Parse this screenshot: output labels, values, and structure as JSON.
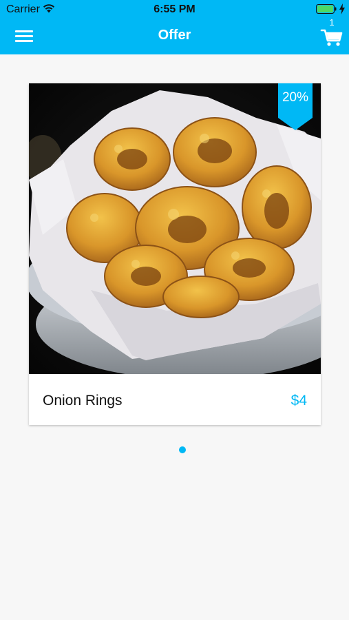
{
  "status_bar": {
    "carrier": "Carrier",
    "time": "6:55 PM"
  },
  "navbar": {
    "title": "Offer",
    "cart_count": "1",
    "menu_icon": "hamburger-menu-icon",
    "cart_icon": "cart-icon"
  },
  "offer": {
    "item_name": "Onion Rings",
    "price": "$4",
    "discount": "20%"
  },
  "pager": {
    "current_page": 1
  },
  "colors": {
    "accent": "#00b8f5",
    "background": "#f7f7f7",
    "battery": "#4cd964"
  }
}
